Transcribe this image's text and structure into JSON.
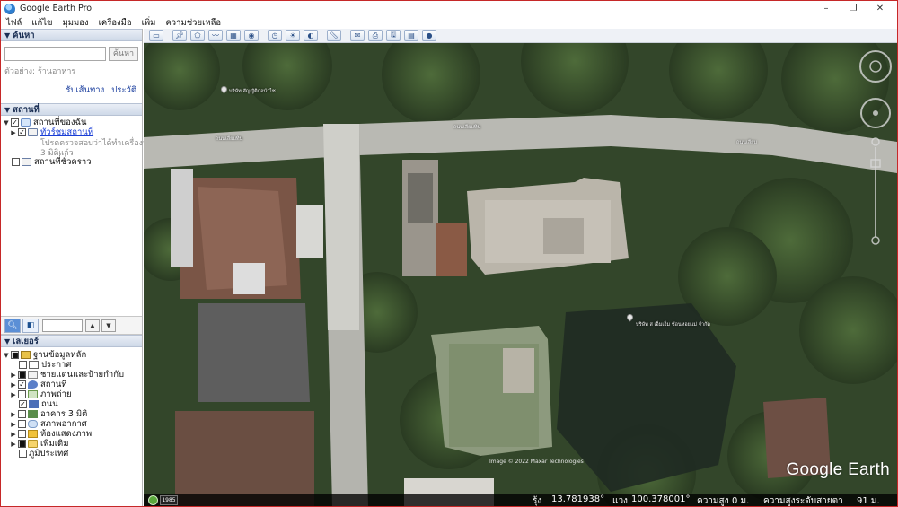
{
  "window": {
    "title": "Google Earth Pro",
    "min": "–",
    "max": "❐",
    "close": "✕"
  },
  "menu": [
    "ไฟล์",
    "แก้ไข",
    "มุมมอง",
    "เครื่องมือ",
    "เพิ่ม",
    "ความช่วยเหลือ"
  ],
  "search": {
    "header": "ค้นหา",
    "placeholder": "",
    "button": "ค้นหา",
    "hint": "ตัวอย่าง: ร้านอาหาร",
    "link_directions": "รับเส้นทาง",
    "link_history": "ประวัติ"
  },
  "places": {
    "header": "สถานที่",
    "my_places": "สถานที่ของฉัน",
    "tour_link": "ทัวร์ชมสถานที่",
    "tour_note1": "โปรดตรวจสอบว่าได้ทำเครื่องหม",
    "tour_note2": "3 มิติแล้ว",
    "temp_places": "สถานที่ชั่วคราว"
  },
  "layers": {
    "header": "เลเยอร์",
    "items": [
      {
        "label": "ฐานข้อมูลหลัก",
        "checked": false
      },
      {
        "label": "ประกาศ",
        "checked": false
      },
      {
        "label": "ชายแดนและป้ายกำกับ",
        "checked": false
      },
      {
        "label": "สถานที่",
        "checked": true
      },
      {
        "label": "ภาพถ่าย",
        "checked": false
      },
      {
        "label": "ถนน",
        "checked": true
      },
      {
        "label": "อาคาร 3 มิติ",
        "checked": false
      },
      {
        "label": "สภาพอากาศ",
        "checked": false
      },
      {
        "label": "ห้องแสดงภาพ",
        "checked": false
      },
      {
        "label": "เพิ่มเติม",
        "checked": false
      },
      {
        "label": "ภูมิประเทศ",
        "checked": false
      }
    ]
  },
  "map": {
    "brand": "Google Earth",
    "copyright": "Image © 2022 Maxar Technologies",
    "year": "1985",
    "labels": {
      "place_top": "บริษัท สัญญัติก่อนำไซ",
      "road_left": "ถนนเลียบทิน",
      "road_mid": "ถนนเลียบทิน",
      "road_right": "ถนนเลียบ",
      "place_right": "บริษัท ส เอ็มเอ็ม ช้อนหอยแม่ จำกัด"
    },
    "status": {
      "lat_label": "รุ้ง",
      "lat": "13.781938°",
      "lon_label": "แวง",
      "lon": "100.378001°",
      "elev_label": "ความสูง",
      "elev": "0 ม.",
      "eye_label": "ความสูงระดับสายตา",
      "eye": "91 ม."
    }
  },
  "colors": {
    "accent": "#1a3ed6",
    "panel_header": "#cfd9e8",
    "road": "#b9b9b3"
  }
}
